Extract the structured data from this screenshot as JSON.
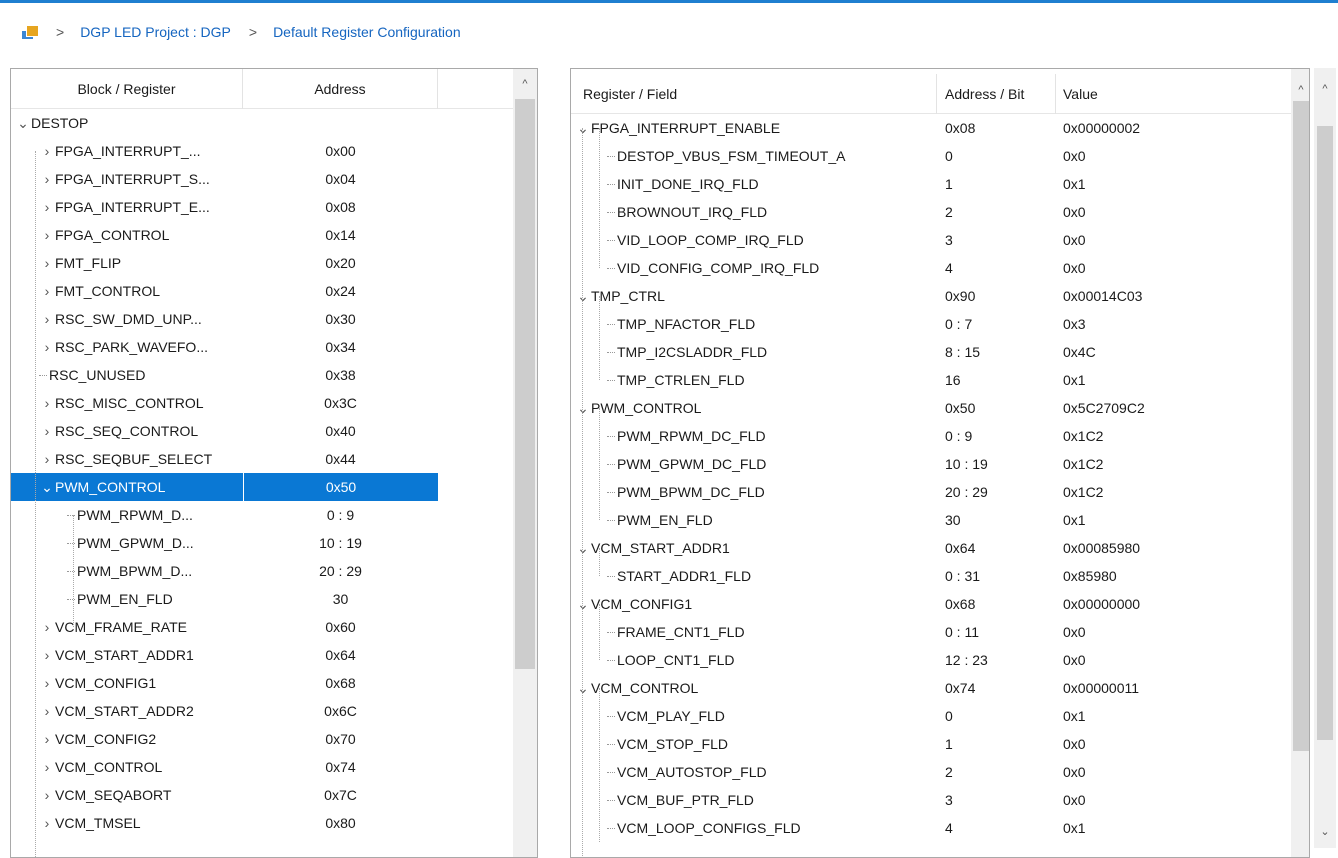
{
  "breadcrumb": {
    "project": "DGP LED Project : DGP",
    "page": "Default Register Configuration",
    "separator": ">"
  },
  "left_panel": {
    "headers": {
      "name": "Block / Register",
      "address": "Address"
    },
    "root": "DESTOP",
    "rows": [
      {
        "name": "FPGA_INTERRUPT_...",
        "address": "0x00",
        "exp": "collapsed",
        "depth": 1
      },
      {
        "name": "FPGA_INTERRUPT_S...",
        "address": "0x04",
        "exp": "collapsed",
        "depth": 1
      },
      {
        "name": "FPGA_INTERRUPT_E...",
        "address": "0x08",
        "exp": "collapsed",
        "depth": 1
      },
      {
        "name": "FPGA_CONTROL",
        "address": "0x14",
        "exp": "collapsed",
        "depth": 1
      },
      {
        "name": "FMT_FLIP",
        "address": "0x20",
        "exp": "collapsed",
        "depth": 1
      },
      {
        "name": "FMT_CONTROL",
        "address": "0x24",
        "exp": "collapsed",
        "depth": 1
      },
      {
        "name": "RSC_SW_DMD_UNP...",
        "address": "0x30",
        "exp": "collapsed",
        "depth": 1
      },
      {
        "name": "RSC_PARK_WAVEFO...",
        "address": "0x34",
        "exp": "collapsed",
        "depth": 1
      },
      {
        "name": "RSC_UNUSED",
        "address": "0x38",
        "exp": "none",
        "depth": 1
      },
      {
        "name": "RSC_MISC_CONTROL",
        "address": "0x3C",
        "exp": "collapsed",
        "depth": 1
      },
      {
        "name": "RSC_SEQ_CONTROL",
        "address": "0x40",
        "exp": "collapsed",
        "depth": 1
      },
      {
        "name": "RSC_SEQBUF_SELECT",
        "address": "0x44",
        "exp": "collapsed",
        "depth": 1
      },
      {
        "name": "PWM_CONTROL",
        "address": "0x50",
        "exp": "expanded",
        "depth": 1,
        "selected": true
      },
      {
        "name": "PWM_RPWM_D...",
        "address": "0 : 9",
        "exp": "none",
        "depth": 2
      },
      {
        "name": "PWM_GPWM_D...",
        "address": "10 : 19",
        "exp": "none",
        "depth": 2
      },
      {
        "name": "PWM_BPWM_D...",
        "address": "20 : 29",
        "exp": "none",
        "depth": 2
      },
      {
        "name": "PWM_EN_FLD",
        "address": "30",
        "exp": "none",
        "depth": 2
      },
      {
        "name": "VCM_FRAME_RATE",
        "address": "0x60",
        "exp": "collapsed",
        "depth": 1
      },
      {
        "name": "VCM_START_ADDR1",
        "address": "0x64",
        "exp": "collapsed",
        "depth": 1
      },
      {
        "name": "VCM_CONFIG1",
        "address": "0x68",
        "exp": "collapsed",
        "depth": 1
      },
      {
        "name": "VCM_START_ADDR2",
        "address": "0x6C",
        "exp": "collapsed",
        "depth": 1
      },
      {
        "name": "VCM_CONFIG2",
        "address": "0x70",
        "exp": "collapsed",
        "depth": 1
      },
      {
        "name": "VCM_CONTROL",
        "address": "0x74",
        "exp": "collapsed",
        "depth": 1
      },
      {
        "name": "VCM_SEQABORT",
        "address": "0x7C",
        "exp": "collapsed",
        "depth": 1
      },
      {
        "name": "VCM_TMSEL",
        "address": "0x80",
        "exp": "collapsed",
        "depth": 1
      }
    ]
  },
  "right_panel": {
    "headers": {
      "name": "Register / Field",
      "address": "Address / Bit",
      "value": "Value"
    },
    "rows": [
      {
        "name": "FPGA_INTERRUPT_ENABLE",
        "address": "0x08",
        "value": "0x00000002",
        "depth": 0
      },
      {
        "name": "DESTOP_VBUS_FSM_TIMEOUT_A",
        "address": "0",
        "value": "0x0",
        "depth": 1
      },
      {
        "name": "INIT_DONE_IRQ_FLD",
        "address": "1",
        "value": "0x1",
        "depth": 1
      },
      {
        "name": "BROWNOUT_IRQ_FLD",
        "address": "2",
        "value": "0x0",
        "depth": 1
      },
      {
        "name": "VID_LOOP_COMP_IRQ_FLD",
        "address": "3",
        "value": "0x0",
        "depth": 1
      },
      {
        "name": "VID_CONFIG_COMP_IRQ_FLD",
        "address": "4",
        "value": "0x0",
        "depth": 1
      },
      {
        "name": "TMP_CTRL",
        "address": "0x90",
        "value": "0x00014C03",
        "depth": 0
      },
      {
        "name": "TMP_NFACTOR_FLD",
        "address": "0 : 7",
        "value": "0x3",
        "depth": 1
      },
      {
        "name": "TMP_I2CSLADDR_FLD",
        "address": "8 : 15",
        "value": "0x4C",
        "depth": 1
      },
      {
        "name": "TMP_CTRLEN_FLD",
        "address": "16",
        "value": "0x1",
        "depth": 1
      },
      {
        "name": "PWM_CONTROL",
        "address": "0x50",
        "value": "0x5C2709C2",
        "depth": 0
      },
      {
        "name": "PWM_RPWM_DC_FLD",
        "address": "0 : 9",
        "value": "0x1C2",
        "depth": 1
      },
      {
        "name": "PWM_GPWM_DC_FLD",
        "address": "10 : 19",
        "value": "0x1C2",
        "depth": 1
      },
      {
        "name": "PWM_BPWM_DC_FLD",
        "address": "20 : 29",
        "value": "0x1C2",
        "depth": 1
      },
      {
        "name": "PWM_EN_FLD",
        "address": "30",
        "value": "0x1",
        "depth": 1
      },
      {
        "name": "VCM_START_ADDR1",
        "address": "0x64",
        "value": "0x00085980",
        "depth": 0
      },
      {
        "name": "START_ADDR1_FLD",
        "address": "0 : 31",
        "value": "0x85980",
        "depth": 1
      },
      {
        "name": "VCM_CONFIG1",
        "address": "0x68",
        "value": "0x00000000",
        "depth": 0
      },
      {
        "name": "FRAME_CNT1_FLD",
        "address": "0 : 11",
        "value": "0x0",
        "depth": 1
      },
      {
        "name": "LOOP_CNT1_FLD",
        "address": "12 : 23",
        "value": "0x0",
        "depth": 1
      },
      {
        "name": "VCM_CONTROL",
        "address": "0x74",
        "value": "0x00000011",
        "depth": 0
      },
      {
        "name": "VCM_PLAY_FLD",
        "address": "0",
        "value": "0x1",
        "depth": 1
      },
      {
        "name": "VCM_STOP_FLD",
        "address": "1",
        "value": "0x0",
        "depth": 1
      },
      {
        "name": "VCM_AUTOSTOP_FLD",
        "address": "2",
        "value": "0x0",
        "depth": 1
      },
      {
        "name": "VCM_BUF_PTR_FLD",
        "address": "3",
        "value": "0x0",
        "depth": 1
      },
      {
        "name": "VCM_LOOP_CONFIGS_FLD",
        "address": "4",
        "value": "0x1",
        "depth": 1
      }
    ]
  },
  "glyphs": {
    "expanded": "⌄",
    "collapsed": "›",
    "up": "^",
    "down": "⌄"
  },
  "colors": {
    "accent": "#0a78d4",
    "link": "#1565c0",
    "topbar": "#1f7fd0"
  }
}
